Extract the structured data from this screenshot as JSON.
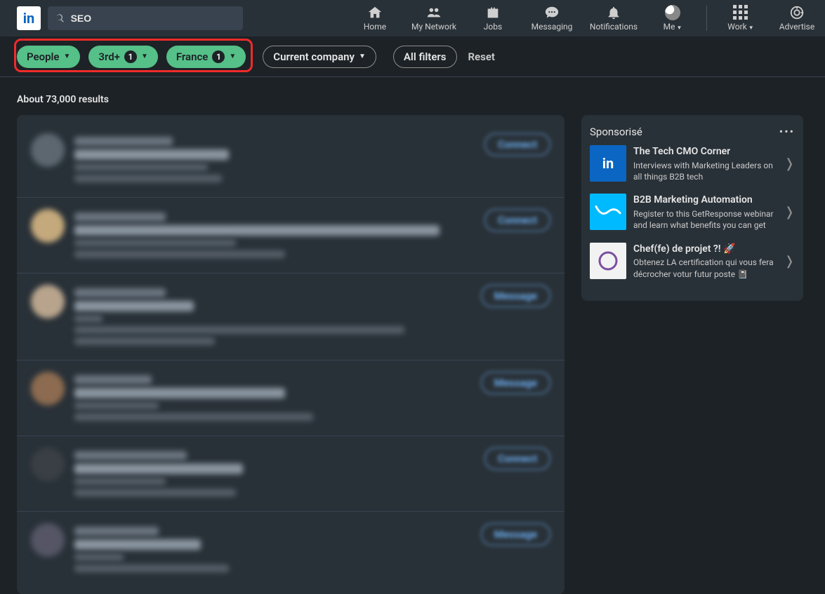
{
  "search": {
    "value": "SEO"
  },
  "nav": {
    "home": "Home",
    "network": "My Network",
    "jobs": "Jobs",
    "messaging": "Messaging",
    "notifications": "Notifications",
    "me": "Me",
    "work": "Work",
    "advertise": "Advertise"
  },
  "filters": {
    "people": "People",
    "connections_label": "3rd+",
    "connections_count": "1",
    "location_label": "France",
    "location_count": "1",
    "company": "Current company",
    "all": "All filters",
    "reset": "Reset"
  },
  "results_count": "About 73,000 results",
  "actions": {
    "connect": "Connect",
    "message": "Message"
  },
  "sidebar": {
    "header": "Sponsorisé",
    "promos": [
      {
        "title": "The Tech CMO Corner",
        "desc": "Interviews with Marketing Leaders on all things B2B tech"
      },
      {
        "title": "B2B Marketing Automation",
        "desc": "Register to this GetResponse webinar and learn what benefits you can get"
      },
      {
        "title": "Chef(fe) de projet ?! 🚀",
        "desc": "Obtenez LA certification qui vous fera décrocher votur futur poste 📓"
      }
    ]
  }
}
